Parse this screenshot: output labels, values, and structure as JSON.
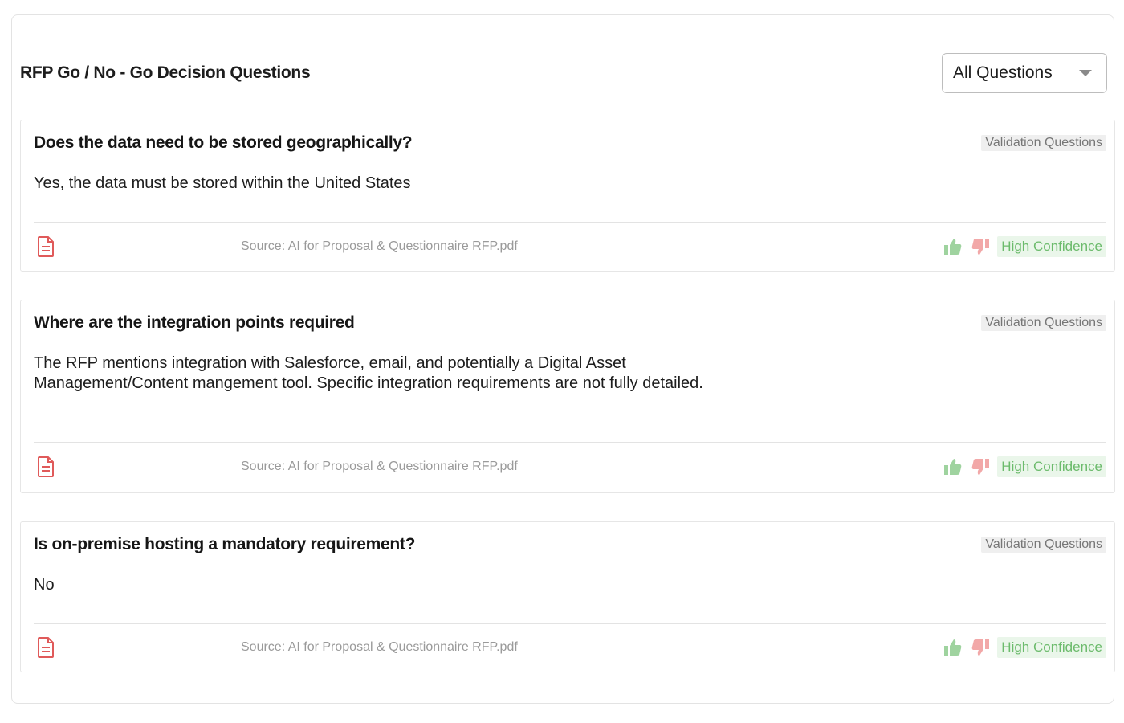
{
  "header": {
    "title": "RFP Go / No - Go Decision Questions",
    "filter_selected": "All Questions"
  },
  "cards": [
    {
      "question": "Does the data need to be stored geographically?",
      "tag": "Validation Questions",
      "answer": "Yes, the data must be stored within the United States",
      "source": "Source: AI for Proposal & Questionnaire RFP.pdf",
      "confidence": "High Confidence"
    },
    {
      "question": "Where are the integration points required",
      "tag": "Validation Questions",
      "answer": "The RFP mentions integration with Salesforce, email, and potentially a Digital Asset Management/Content mangement tool. Specific integration requirements are not fully detailed.",
      "source": "Source: AI for Proposal & Questionnaire RFP.pdf",
      "confidence": "High Confidence"
    },
    {
      "question": "Is on-premise hosting a mandatory requirement?",
      "tag": "Validation Questions",
      "answer": "No",
      "source": "Source: AI for Proposal & Questionnaire RFP.pdf",
      "confidence": "High Confidence"
    }
  ],
  "icons": {
    "document": "document-icon",
    "thumbs_up": "thumbs-up-icon",
    "thumbs_down": "thumbs-down-icon"
  },
  "colors": {
    "document_icon": "#e05a5a",
    "thumbs_up": "#9fd39f",
    "thumbs_down": "#f2a8a8",
    "confidence_text": "#6cbb6c",
    "confidence_bg": "#eaf6ea"
  }
}
